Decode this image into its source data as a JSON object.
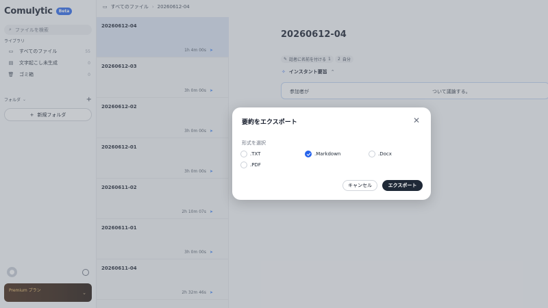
{
  "app": {
    "name": "Comulytic",
    "badge": "Beta"
  },
  "sidebar": {
    "search_placeholder": "ファイルを検索",
    "library_label": "ライブラリ",
    "items": [
      {
        "label": "すべてのファイル",
        "count": "55"
      },
      {
        "label": "文字起こし未生成",
        "count": "0"
      },
      {
        "label": "ゴミ箱",
        "count": "0"
      }
    ],
    "folders_label": "フォルダ",
    "new_folder_label": "新規フォルダ",
    "premium_label": "Premium プラン"
  },
  "breadcrumb": {
    "root": "すべてのファイル",
    "current": "20260612-04"
  },
  "recordings": [
    {
      "name": "20260612-04",
      "duration": "1h 4m 00s"
    },
    {
      "name": "20260612-03",
      "duration": "3h 0m 00s"
    },
    {
      "name": "20260612-02",
      "duration": "3h 0m 00s"
    },
    {
      "name": "20260612-01",
      "duration": "3h 0m 00s"
    },
    {
      "name": "20260611-02",
      "duration": "2h 10m 07s"
    },
    {
      "name": "20260611-01",
      "duration": "3h 0m 00s"
    },
    {
      "name": "20260611-04",
      "duration": "2h 32m 46s"
    }
  ],
  "main": {
    "title": "20260612-04",
    "chip_speaker": "話者に名前を付ける",
    "chip_speaker_count": "1",
    "chip_self": "自分",
    "chip_self_count": "2",
    "summary_title": "インスタント要旨",
    "summary_text_a": "参加者が",
    "summary_text_b": "ついて議論する。"
  },
  "modal": {
    "title": "要約をエクスポート",
    "format_label": "形式を選択",
    "options": [
      ".TXT",
      ".Markdown",
      ".Docx",
      ".PDF"
    ],
    "selected": ".Markdown",
    "cancel": "キャンセル",
    "export": "エクスポート"
  },
  "colors": {
    "accent": "#2563eb",
    "dark_button": "#1f2937",
    "premium_gold": "#f5c56b"
  }
}
